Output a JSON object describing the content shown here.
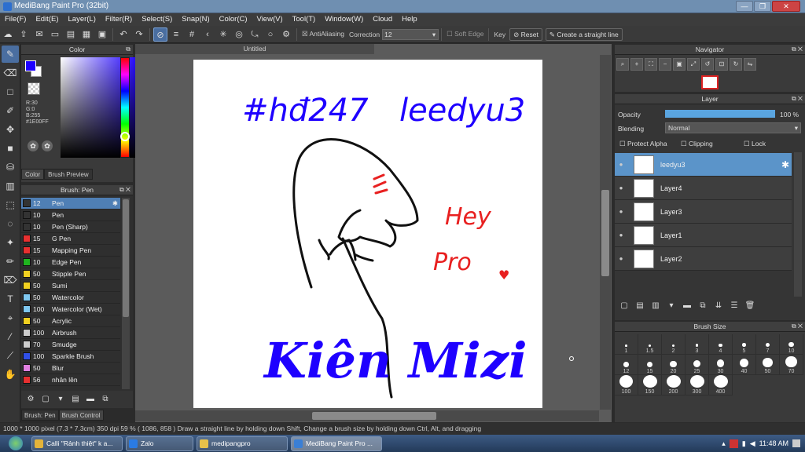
{
  "window": {
    "title": "MediBang Paint Pro (32bit)",
    "buttons": [
      "—",
      "❐",
      "✕"
    ]
  },
  "menu": [
    "File(F)",
    "Edit(E)",
    "Layer(L)",
    "Filter(R)",
    "Select(S)",
    "Snap(N)",
    "Color(C)",
    "View(V)",
    "Tool(T)",
    "Window(W)",
    "Cloud",
    "Help"
  ],
  "toolbar": {
    "antialiasing": "AntiAliasing",
    "correction_label": "Correction",
    "correction_value": "12",
    "soft_edge": "Soft Edge",
    "key": "Key",
    "reset": "Reset",
    "create_line": "Create a straight line"
  },
  "color_panel": {
    "title": "Color",
    "rgb": "R:30\nG:0\nB:255",
    "hex": "#1E00FF",
    "tabs": [
      "Color",
      "Brush Preview"
    ],
    "fg": "#1E00FF"
  },
  "brush_panel": {
    "title": "Brush: Pen",
    "items": [
      {
        "size": "12",
        "name": "Pen",
        "color": "#333333"
      },
      {
        "size": "10",
        "name": "Pen",
        "color": "#333333"
      },
      {
        "size": "10",
        "name": "Pen (Sharp)",
        "color": "#333333"
      },
      {
        "size": "15",
        "name": "G Pen",
        "color": "#e83030"
      },
      {
        "size": "15",
        "name": "Mapping Pen",
        "color": "#e83030"
      },
      {
        "size": "10",
        "name": "Edge Pen",
        "color": "#1fb51f"
      },
      {
        "size": "50",
        "name": "Stipple Pen",
        "color": "#f0d020"
      },
      {
        "size": "50",
        "name": "Sumi",
        "color": "#f0d020"
      },
      {
        "size": "50",
        "name": "Watercolor",
        "color": "#7fc8f0"
      },
      {
        "size": "100",
        "name": "Watercolor (Wet)",
        "color": "#7fc8f0"
      },
      {
        "size": "50",
        "name": "Acrylic",
        "color": "#f0d020"
      },
      {
        "size": "100",
        "name": "Airbrush",
        "color": "#cccccc"
      },
      {
        "size": "70",
        "name": "Smudge",
        "color": "#cccccc"
      },
      {
        "size": "100",
        "name": "Sparkle Brush",
        "color": "#3050e8"
      },
      {
        "size": "50",
        "name": "Blur",
        "color": "#e080e0"
      },
      {
        "size": "56",
        "name": "nhân lên",
        "color": "#e83030"
      }
    ],
    "tabs": [
      "Brush: Pen",
      "Brush Control"
    ]
  },
  "canvas": {
    "tab": "Untitled",
    "texts": {
      "hashtag": "#hđ247",
      "name_top": "leedyu3",
      "hey": "Hey",
      "pro": "Pro",
      "heart": "♥",
      "bottom": "Kiên Mizi"
    }
  },
  "navigator": {
    "title": "Navigator"
  },
  "layer_panel": {
    "title": "Layer",
    "opacity_label": "Opacity",
    "opacity_value": "100 %",
    "opacity_fraction": 1.0,
    "blending_label": "Blending",
    "blending_value": "Normal",
    "protect_alpha": "Protect Alpha",
    "clipping": "Clipping",
    "lock": "Lock",
    "layers": [
      "leedyu3",
      "Layer4",
      "Layer3",
      "Layer1",
      "Layer2"
    ]
  },
  "brush_size": {
    "title": "Brush Size",
    "sizes": [
      "1",
      "1.5",
      "2",
      "3",
      "4",
      "5",
      "7",
      "10",
      "12",
      "15",
      "20",
      "25",
      "30",
      "40",
      "50",
      "70",
      "100",
      "150",
      "200",
      "300",
      "400"
    ]
  },
  "status": "1000 * 1000 pixel   (7.3 * 7.3cm)   350 dpi   59 %   ( 1086, 858 )   Draw a straight line by holding down Shift, Change a brush size by holding down Ctrl, Alt, and dragging",
  "taskbar": {
    "items": [
      "Calli \"Rảnh thiệt\" k a...",
      "Zalo",
      "medipangpro",
      "MediBang Paint Pro ..."
    ],
    "time": "11:48 AM"
  }
}
